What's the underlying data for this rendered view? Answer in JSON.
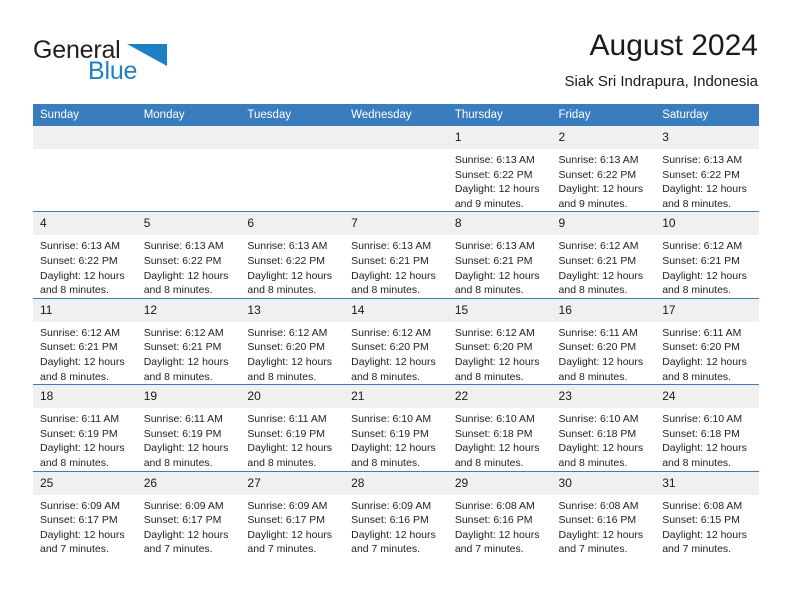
{
  "brand": {
    "name_part1": "General",
    "name_part2": "Blue",
    "accent_color": "#1f7fc4",
    "triangle_icon": "triangle-icon"
  },
  "header": {
    "title": "August 2024",
    "subtitle": "Siak Sri Indrapura, Indonesia"
  },
  "calendar": {
    "header_bg": "#3a7dbf",
    "daynum_bg": "#f0f0f0",
    "weekdays": [
      "Sunday",
      "Monday",
      "Tuesday",
      "Wednesday",
      "Thursday",
      "Friday",
      "Saturday"
    ],
    "weeks": [
      [
        {
          "day": "",
          "lines": []
        },
        {
          "day": "",
          "lines": []
        },
        {
          "day": "",
          "lines": []
        },
        {
          "day": "",
          "lines": []
        },
        {
          "day": "1",
          "lines": [
            "Sunrise: 6:13 AM",
            "Sunset: 6:22 PM",
            "Daylight: 12 hours",
            "and 9 minutes."
          ]
        },
        {
          "day": "2",
          "lines": [
            "Sunrise: 6:13 AM",
            "Sunset: 6:22 PM",
            "Daylight: 12 hours",
            "and 9 minutes."
          ]
        },
        {
          "day": "3",
          "lines": [
            "Sunrise: 6:13 AM",
            "Sunset: 6:22 PM",
            "Daylight: 12 hours",
            "and 8 minutes."
          ]
        }
      ],
      [
        {
          "day": "4",
          "lines": [
            "Sunrise: 6:13 AM",
            "Sunset: 6:22 PM",
            "Daylight: 12 hours",
            "and 8 minutes."
          ]
        },
        {
          "day": "5",
          "lines": [
            "Sunrise: 6:13 AM",
            "Sunset: 6:22 PM",
            "Daylight: 12 hours",
            "and 8 minutes."
          ]
        },
        {
          "day": "6",
          "lines": [
            "Sunrise: 6:13 AM",
            "Sunset: 6:22 PM",
            "Daylight: 12 hours",
            "and 8 minutes."
          ]
        },
        {
          "day": "7",
          "lines": [
            "Sunrise: 6:13 AM",
            "Sunset: 6:21 PM",
            "Daylight: 12 hours",
            "and 8 minutes."
          ]
        },
        {
          "day": "8",
          "lines": [
            "Sunrise: 6:13 AM",
            "Sunset: 6:21 PM",
            "Daylight: 12 hours",
            "and 8 minutes."
          ]
        },
        {
          "day": "9",
          "lines": [
            "Sunrise: 6:12 AM",
            "Sunset: 6:21 PM",
            "Daylight: 12 hours",
            "and 8 minutes."
          ]
        },
        {
          "day": "10",
          "lines": [
            "Sunrise: 6:12 AM",
            "Sunset: 6:21 PM",
            "Daylight: 12 hours",
            "and 8 minutes."
          ]
        }
      ],
      [
        {
          "day": "11",
          "lines": [
            "Sunrise: 6:12 AM",
            "Sunset: 6:21 PM",
            "Daylight: 12 hours",
            "and 8 minutes."
          ]
        },
        {
          "day": "12",
          "lines": [
            "Sunrise: 6:12 AM",
            "Sunset: 6:21 PM",
            "Daylight: 12 hours",
            "and 8 minutes."
          ]
        },
        {
          "day": "13",
          "lines": [
            "Sunrise: 6:12 AM",
            "Sunset: 6:20 PM",
            "Daylight: 12 hours",
            "and 8 minutes."
          ]
        },
        {
          "day": "14",
          "lines": [
            "Sunrise: 6:12 AM",
            "Sunset: 6:20 PM",
            "Daylight: 12 hours",
            "and 8 minutes."
          ]
        },
        {
          "day": "15",
          "lines": [
            "Sunrise: 6:12 AM",
            "Sunset: 6:20 PM",
            "Daylight: 12 hours",
            "and 8 minutes."
          ]
        },
        {
          "day": "16",
          "lines": [
            "Sunrise: 6:11 AM",
            "Sunset: 6:20 PM",
            "Daylight: 12 hours",
            "and 8 minutes."
          ]
        },
        {
          "day": "17",
          "lines": [
            "Sunrise: 6:11 AM",
            "Sunset: 6:20 PM",
            "Daylight: 12 hours",
            "and 8 minutes."
          ]
        }
      ],
      [
        {
          "day": "18",
          "lines": [
            "Sunrise: 6:11 AM",
            "Sunset: 6:19 PM",
            "Daylight: 12 hours",
            "and 8 minutes."
          ]
        },
        {
          "day": "19",
          "lines": [
            "Sunrise: 6:11 AM",
            "Sunset: 6:19 PM",
            "Daylight: 12 hours",
            "and 8 minutes."
          ]
        },
        {
          "day": "20",
          "lines": [
            "Sunrise: 6:11 AM",
            "Sunset: 6:19 PM",
            "Daylight: 12 hours",
            "and 8 minutes."
          ]
        },
        {
          "day": "21",
          "lines": [
            "Sunrise: 6:10 AM",
            "Sunset: 6:19 PM",
            "Daylight: 12 hours",
            "and 8 minutes."
          ]
        },
        {
          "day": "22",
          "lines": [
            "Sunrise: 6:10 AM",
            "Sunset: 6:18 PM",
            "Daylight: 12 hours",
            "and 8 minutes."
          ]
        },
        {
          "day": "23",
          "lines": [
            "Sunrise: 6:10 AM",
            "Sunset: 6:18 PM",
            "Daylight: 12 hours",
            "and 8 minutes."
          ]
        },
        {
          "day": "24",
          "lines": [
            "Sunrise: 6:10 AM",
            "Sunset: 6:18 PM",
            "Daylight: 12 hours",
            "and 8 minutes."
          ]
        }
      ],
      [
        {
          "day": "25",
          "lines": [
            "Sunrise: 6:09 AM",
            "Sunset: 6:17 PM",
            "Daylight: 12 hours",
            "and 7 minutes."
          ]
        },
        {
          "day": "26",
          "lines": [
            "Sunrise: 6:09 AM",
            "Sunset: 6:17 PM",
            "Daylight: 12 hours",
            "and 7 minutes."
          ]
        },
        {
          "day": "27",
          "lines": [
            "Sunrise: 6:09 AM",
            "Sunset: 6:17 PM",
            "Daylight: 12 hours",
            "and 7 minutes."
          ]
        },
        {
          "day": "28",
          "lines": [
            "Sunrise: 6:09 AM",
            "Sunset: 6:16 PM",
            "Daylight: 12 hours",
            "and 7 minutes."
          ]
        },
        {
          "day": "29",
          "lines": [
            "Sunrise: 6:08 AM",
            "Sunset: 6:16 PM",
            "Daylight: 12 hours",
            "and 7 minutes."
          ]
        },
        {
          "day": "30",
          "lines": [
            "Sunrise: 6:08 AM",
            "Sunset: 6:16 PM",
            "Daylight: 12 hours",
            "and 7 minutes."
          ]
        },
        {
          "day": "31",
          "lines": [
            "Sunrise: 6:08 AM",
            "Sunset: 6:15 PM",
            "Daylight: 12 hours",
            "and 7 minutes."
          ]
        }
      ]
    ]
  }
}
